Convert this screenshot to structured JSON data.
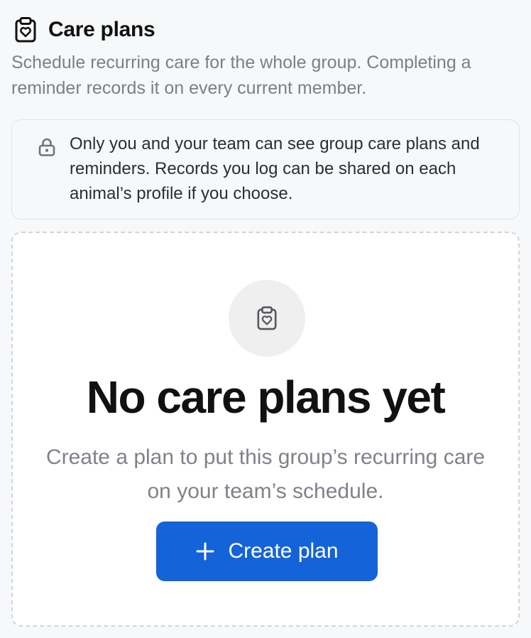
{
  "header": {
    "title": "Care plans",
    "icon": "clipboard-heart-icon"
  },
  "description": "Schedule recurring care for the whole group. Completing a reminder records it on every current member.",
  "privacy_note": {
    "icon": "lock-icon",
    "text": "Only you and your team can see group care plans and reminders. Records you log can be shared on each animal’s profile if you choose."
  },
  "empty_state": {
    "icon": "clipboard-heart-icon",
    "title": "No care plans yet",
    "description": "Create a plan to put this group’s recurring care on your team’s schedule.",
    "button": {
      "icon": "plus-icon",
      "label": "Create plan"
    }
  },
  "colors": {
    "accent": "#1463d9",
    "background": "#f7f8fa",
    "muted_text": "#7b7f86"
  }
}
